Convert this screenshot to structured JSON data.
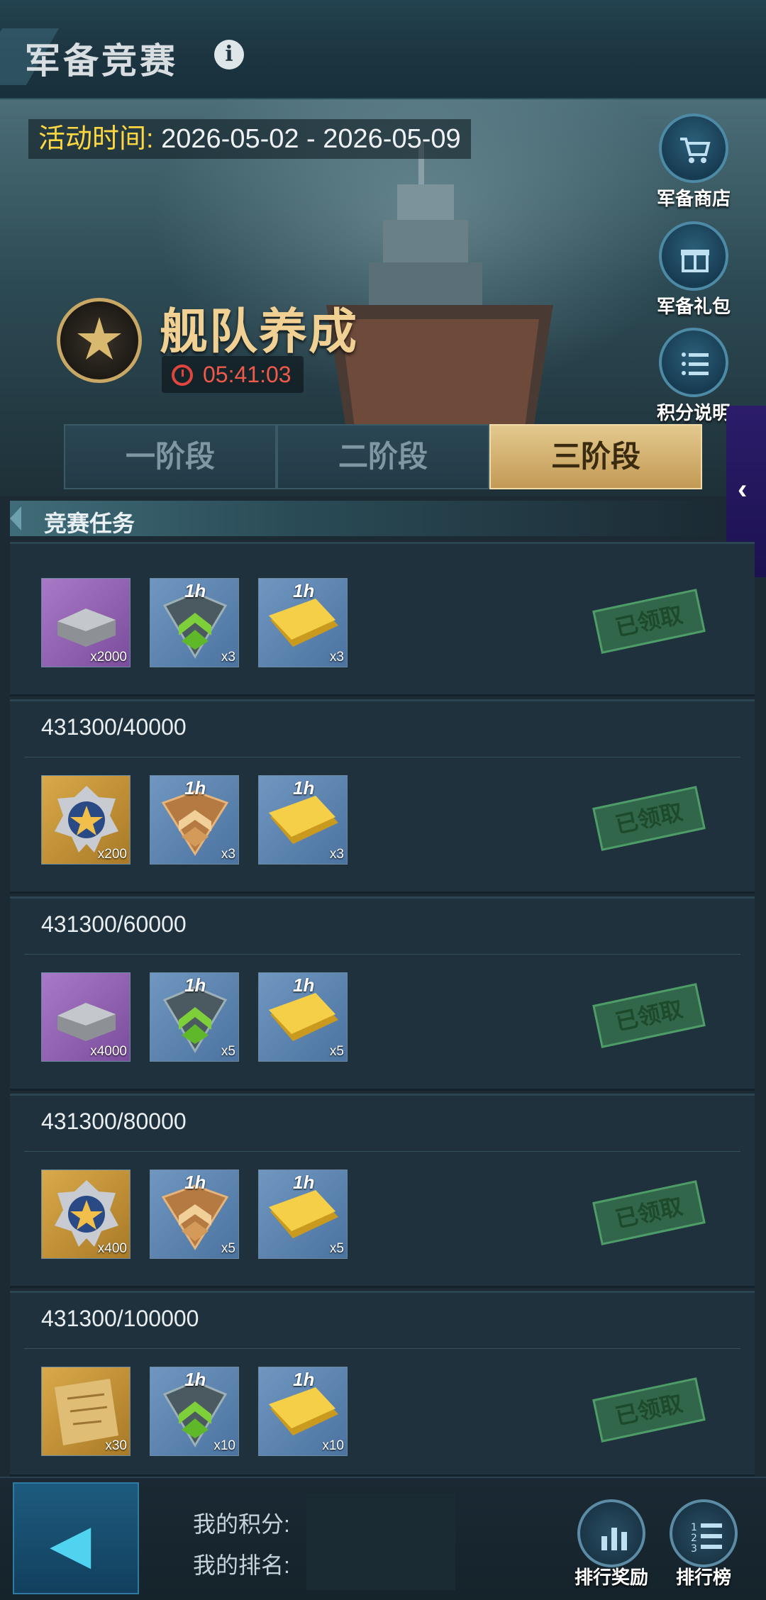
{
  "header": {
    "title": "军备竞赛",
    "info_icon": "info-icon"
  },
  "banner": {
    "event_time_label": "活动时间:",
    "event_time_value": "2026-05-02 - 2026-05-09",
    "event_name": "舰队养成",
    "countdown": "05:41:03"
  },
  "side_buttons": [
    {
      "label": "军备商店",
      "icon": "cart-icon"
    },
    {
      "label": "军备礼包",
      "icon": "gift-icon"
    },
    {
      "label": "积分说明",
      "icon": "list-icon"
    }
  ],
  "tabs": [
    {
      "label": "一阶段",
      "active": false
    },
    {
      "label": "二阶段",
      "active": false
    },
    {
      "label": "三阶段",
      "active": true
    }
  ],
  "side_tab_arrow": "‹",
  "section": {
    "title": "竞赛任务"
  },
  "tasks": [
    {
      "progress": "",
      "status": "已领取",
      "rewards": [
        {
          "type": "iron-ingot",
          "qty": "x2000"
        },
        {
          "type": "green-speedup",
          "qty": "x3"
        },
        {
          "type": "gold-speedup",
          "qty": "x3"
        }
      ]
    },
    {
      "progress": "431300/40000",
      "status": "已领取",
      "rewards": [
        {
          "type": "star-medal",
          "qty": "x200"
        },
        {
          "type": "bronze-speedup",
          "qty": "x3"
        },
        {
          "type": "gold-speedup",
          "qty": "x3"
        }
      ]
    },
    {
      "progress": "431300/60000",
      "status": "已领取",
      "rewards": [
        {
          "type": "iron-ingot",
          "qty": "x4000"
        },
        {
          "type": "green-speedup",
          "qty": "x5"
        },
        {
          "type": "gold-speedup",
          "qty": "x5"
        }
      ]
    },
    {
      "progress": "431300/80000",
      "status": "已领取",
      "rewards": [
        {
          "type": "star-medal",
          "qty": "x400"
        },
        {
          "type": "bronze-speedup",
          "qty": "x5"
        },
        {
          "type": "gold-speedup",
          "qty": "x5"
        }
      ]
    },
    {
      "progress": "431300/100000",
      "status": "已领取",
      "rewards": [
        {
          "type": "blueprint",
          "qty": "x30"
        },
        {
          "type": "green-speedup",
          "qty": "x10"
        },
        {
          "type": "gold-speedup",
          "qty": "x10"
        }
      ]
    }
  ],
  "speedup_tag": "1h",
  "bottom": {
    "my_score_label": "我的积分:",
    "my_rank_label": "我的排名:",
    "rank_reward_label": "排行奖励",
    "leaderboard_label": "排行榜"
  },
  "colors": {
    "accent_gold": "#e3c98e",
    "countdown_red": "#f05a4a",
    "stamp_green": "#4e9c68"
  }
}
